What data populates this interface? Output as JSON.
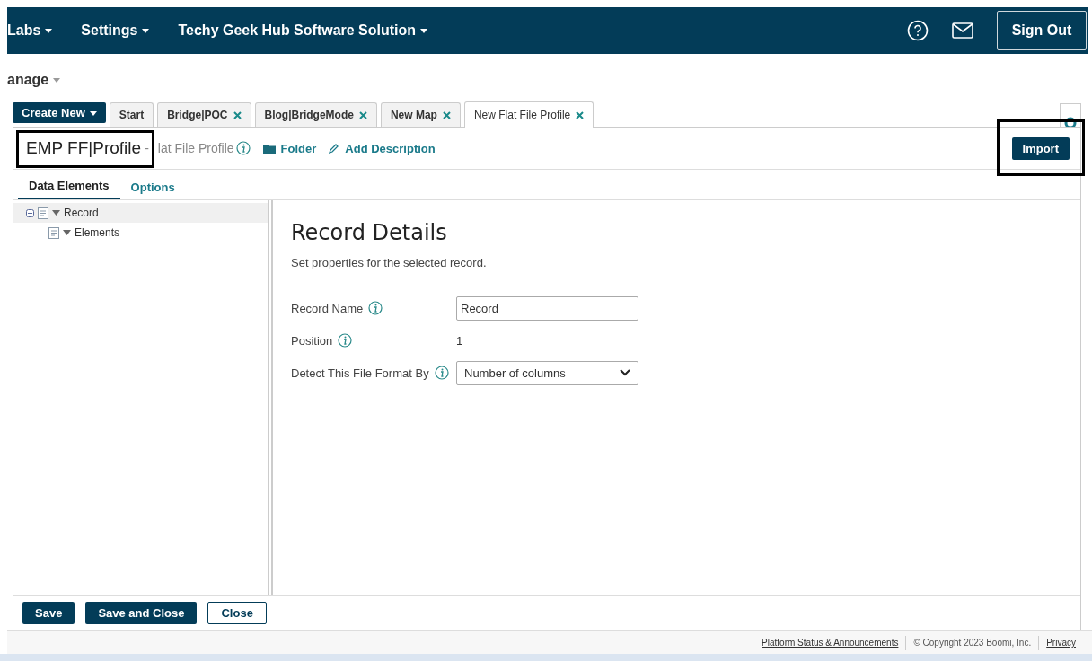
{
  "nav": {
    "items": [
      {
        "label": "Labs"
      },
      {
        "label": "Settings"
      },
      {
        "label": "Techy Geek Hub Software Solution"
      }
    ],
    "sign_out": "Sign Out"
  },
  "breadcrumb": "anage",
  "create_new": "Create New",
  "tabs": [
    {
      "label": "Start",
      "closable": false,
      "selected": false
    },
    {
      "label": "Bridge|POC",
      "closable": true,
      "selected": false
    },
    {
      "label": "Blog|BridgeMode",
      "closable": true,
      "selected": false
    },
    {
      "label": "New Map",
      "closable": true,
      "selected": false
    },
    {
      "label": "New Flat File Profile",
      "closable": true,
      "selected": true
    }
  ],
  "header": {
    "title": "EMP FF|Profile",
    "separator": "-",
    "type": "lat File Profile",
    "folder": "Folder",
    "add_description": "Add Description",
    "import": "Import"
  },
  "subtabs": [
    {
      "label": "Data Elements",
      "selected": true
    },
    {
      "label": "Options",
      "selected": false
    }
  ],
  "tree": [
    {
      "label": "Record",
      "expanded": true,
      "selected": true,
      "children": [
        {
          "label": "Elements",
          "expanded": true,
          "selected": false
        }
      ]
    }
  ],
  "details": {
    "title": "Record Details",
    "description": "Set properties for the selected record.",
    "fields": [
      {
        "kind": "text",
        "label": "Record Name",
        "value": "Record"
      },
      {
        "kind": "static",
        "label": "Position",
        "value": "1"
      },
      {
        "kind": "select",
        "label": "Detect This File Format By",
        "value": "Number of columns"
      }
    ]
  },
  "buttons": [
    {
      "label": "Save",
      "kind": "primary"
    },
    {
      "label": "Save and Close",
      "kind": "primary"
    },
    {
      "label": "Close",
      "kind": "secondary"
    }
  ],
  "footer": {
    "links": [
      "Platform Status & Announcements"
    ],
    "copyright": "© Copyright 2023 Boomi, Inc.",
    "privacy": "Privacy"
  }
}
